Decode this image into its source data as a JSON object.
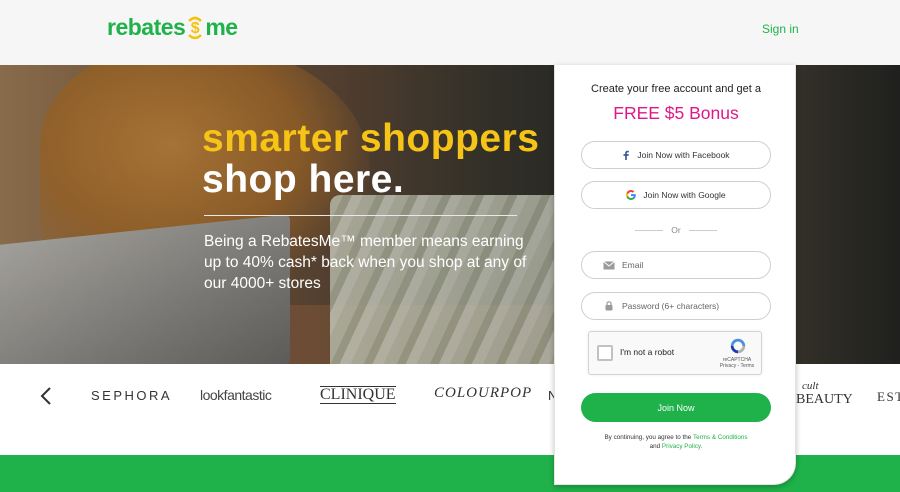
{
  "header": {
    "logo_left": "rebates",
    "logo_right": "me",
    "signin_label": "Sign in"
  },
  "hero": {
    "headline_line1": "smarter shoppers",
    "headline_line2": "shop here.",
    "subtext": "Being a RebatesMe™ member means earning up to 40% cash* back when you shop at any of our 4000+ stores"
  },
  "brands": {
    "items": [
      "SEPHORA",
      "lookfantastic",
      "CLINIQUE",
      "COLOURPOP",
      "N",
      "BEAUTY",
      "EST"
    ],
    "cult_small": "cult"
  },
  "signup": {
    "intro": "Create your free account and get a",
    "bonus": "FREE $5 Bonus",
    "facebook_label": "Join Now with Facebook",
    "google_label": "Join Now with Google",
    "or_label": "Or",
    "email_placeholder": "Email",
    "password_placeholder": "Password (6+ characters)",
    "captcha_label": "I'm not a robot",
    "captcha_brand": "reCAPTCHA",
    "captcha_links": "Privacy - Terms",
    "join_label": "Join Now",
    "legal_prefix": "By continuing, you agree to the",
    "terms_link": "Terms & Conditions",
    "legal_and": "and",
    "privacy_link": "Privacy Policy."
  },
  "colors": {
    "brand_green": "#1fb24a",
    "brand_yellow": "#f6c417",
    "bonus_pink": "#e0178b"
  }
}
